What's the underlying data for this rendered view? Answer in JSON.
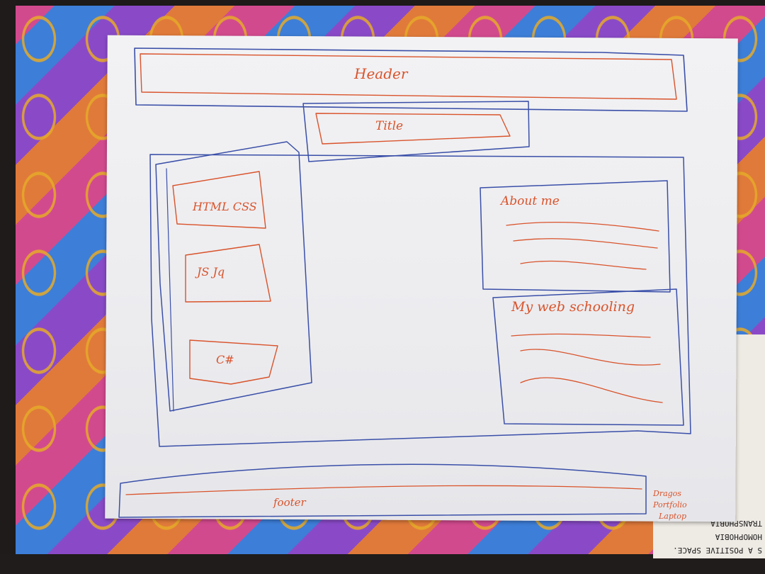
{
  "sketch": {
    "header_label": "Header",
    "title_label": "Title",
    "sidebar_items": [
      {
        "label": "HTML CSS"
      },
      {
        "label": "JS Jq"
      },
      {
        "label": "C#"
      }
    ],
    "about_heading": "About me",
    "schooling_heading": "My web schooling",
    "footer_label": "footer",
    "note_lines": [
      "Dragos",
      "Portfolio",
      "Laptop"
    ]
  },
  "sticker": {
    "lines": [
      "S A POSITIVE SPACE.",
      "HOMOPHOBIA",
      "TRANSPHOBIA"
    ]
  },
  "colors": {
    "pen_blue": "#3a4fa8",
    "pen_orange": "#d9532b",
    "paper": "#eeeef1"
  }
}
